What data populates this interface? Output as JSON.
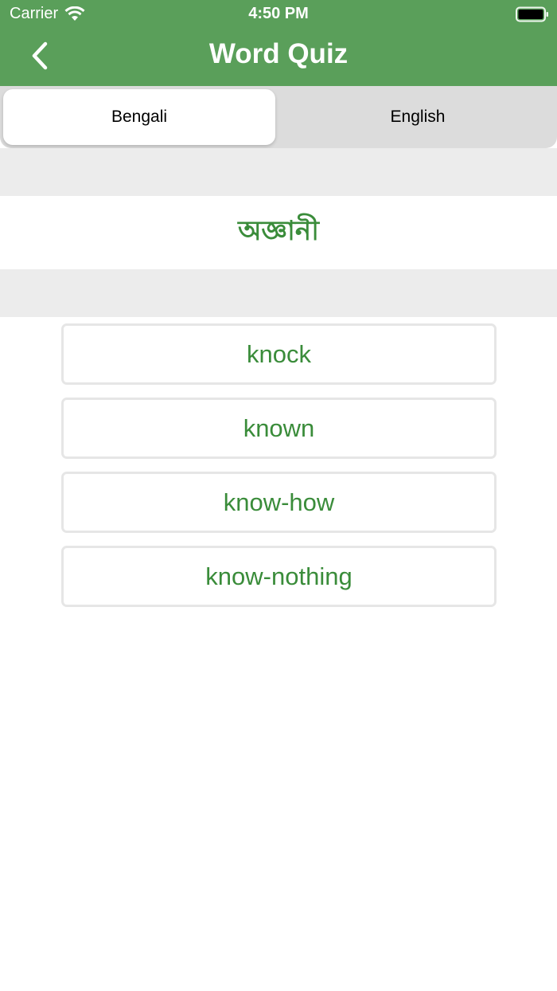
{
  "status_bar": {
    "carrier": "Carrier",
    "time": "4:50 PM",
    "icons": [
      "wifi-icon",
      "battery-icon"
    ]
  },
  "nav": {
    "back_icon": "chevron-left-icon",
    "title": "Word Quiz"
  },
  "segments": {
    "items": [
      "Bengali",
      "English"
    ],
    "selected": "Bengali"
  },
  "quiz": {
    "question": "অজ্ঞানী",
    "options": [
      "knock",
      "known",
      "know-how",
      "know-nothing"
    ]
  },
  "colors": {
    "header": "#5a9f5a",
    "accent_text": "#3a8c3a",
    "segment_track": "#dcdcdc",
    "band": "#ececec"
  }
}
